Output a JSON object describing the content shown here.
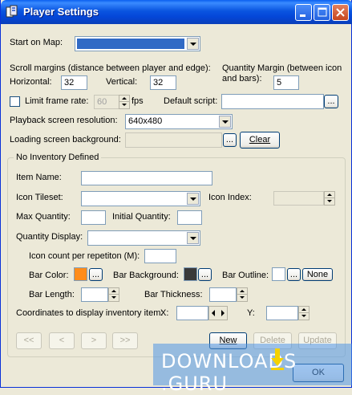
{
  "window": {
    "title": "Player Settings"
  },
  "start_map": {
    "label": "Start on Map:",
    "value": ""
  },
  "scroll_margins": {
    "label": "Scroll margins (distance between player and edge):",
    "horizontal_label": "Horizontal:",
    "horizontal_value": "32",
    "vertical_label": "Vertical:",
    "vertical_value": "32"
  },
  "quantity_margin": {
    "label": "Quantity Margin (between icon and bars):",
    "value": "5"
  },
  "frame_rate": {
    "label": "Limit frame rate:",
    "value": "60",
    "unit": "fps",
    "checked": false
  },
  "default_script": {
    "label": "Default script:",
    "value": "",
    "browse": "..."
  },
  "playback": {
    "label": "Playback screen resolution:",
    "value": "640x480"
  },
  "loading_bg": {
    "label": "Loading screen background:",
    "value": "",
    "browse": "...",
    "clear": "Clear"
  },
  "inventory": {
    "group_label": "No Inventory Defined",
    "item_name_label": "Item Name:",
    "item_name_value": "",
    "icon_tileset_label": "Icon Tileset:",
    "icon_tileset_value": "",
    "icon_index_label": "Icon Index:",
    "icon_index_value": "",
    "max_qty_label": "Max Quantity:",
    "max_qty_value": "",
    "initial_qty_label": "Initial Quantity:",
    "initial_qty_value": "",
    "qty_display_label": "Quantity Display:",
    "qty_display_value": "",
    "icon_count_label": "Icon count per repetiton (M):",
    "icon_count_value": "",
    "bar_color_label": "Bar Color:",
    "bar_color": "#FF8C1A",
    "bar_bg_label": "Bar Background:",
    "bar_bg": "#3A3A3A",
    "bar_outline_label": "Bar Outline:",
    "bar_outline": "#FFFFFF",
    "browse": "...",
    "none": "None",
    "bar_length_label": "Bar Length:",
    "bar_length_value": "",
    "bar_thickness_label": "Bar Thickness:",
    "bar_thickness_value": "",
    "coords_label": "Coordinates to display inventory item:",
    "x_label": "X:",
    "x_value": "",
    "y_label": "Y:",
    "y_value": ""
  },
  "nav": {
    "first": "<<",
    "prev": "<",
    "next": ">",
    "last": ">>",
    "new": "New",
    "delete": "Delete",
    "update": "Update"
  },
  "footer": {
    "ok": "OK"
  },
  "watermark": {
    "text_left": "DOWNLOADS",
    "text_right": ".GURU"
  }
}
